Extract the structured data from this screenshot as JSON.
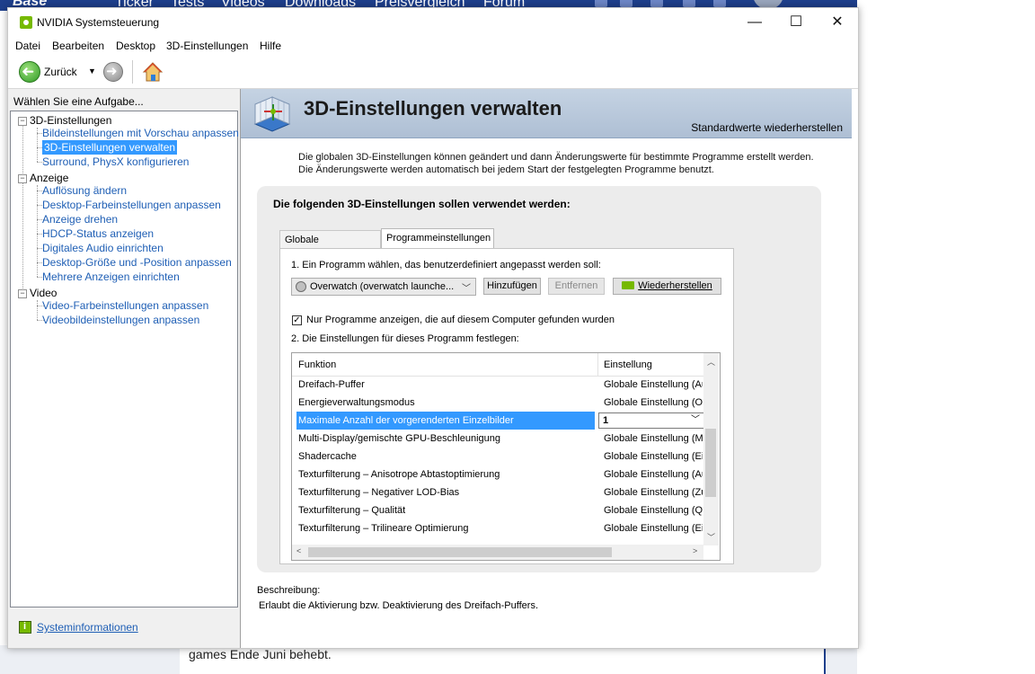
{
  "background_page": {
    "brand": "Base",
    "nav_items": [
      "Ticker",
      "Tests",
      "Videos",
      "Downloads",
      "Preisvergleich",
      "Forum"
    ],
    "article_text": "games Ende Juni behebt."
  },
  "window": {
    "title": "NVIDIA Systemsteuerung",
    "controls": {
      "minimize": "—",
      "maximize": "☐",
      "close": "✕"
    }
  },
  "menu": [
    "Datei",
    "Bearbeiten",
    "Desktop",
    "3D-Einstellungen",
    "Hilfe"
  ],
  "toolbar": {
    "back_label": "Zurück"
  },
  "left_panel": {
    "header": "Wählen Sie eine Aufgabe...",
    "groups": [
      {
        "label": "3D-Einstellungen",
        "items": [
          "Bildeinstellungen mit Vorschau anpassen",
          "3D-Einstellungen verwalten",
          "Surround, PhysX konfigurieren"
        ]
      },
      {
        "label": "Anzeige",
        "items": [
          "Auflösung ändern",
          "Desktop-Farbeinstellungen anpassen",
          "Anzeige drehen",
          "HDCP-Status anzeigen",
          "Digitales Audio einrichten",
          "Desktop-Größe und -Position anpassen",
          "Mehrere Anzeigen einrichten"
        ]
      },
      {
        "label": "Video",
        "items": [
          "Video-Farbeinstellungen anpassen",
          "Videobildeinstellungen anpassen"
        ]
      }
    ],
    "selected_item": "3D-Einstellungen verwalten",
    "system_info_link": "Systeminformationen"
  },
  "main": {
    "title": "3D-Einstellungen verwalten",
    "restore_defaults": "Standardwerte wiederherstellen",
    "intro": "Die globalen 3D-Einstellungen können geändert und dann Änderungswerte für bestimmte Programme erstellt werden. Die Änderungswerte werden automatisch bei jedem Start der festgelegten Programme benutzt.",
    "group_heading": "Die folgenden 3D-Einstellungen sollen verwendet werden:",
    "tabs": [
      "Globale Einstellungen",
      "Programmeinstellungen"
    ],
    "active_tab": "Programmeinstellungen",
    "step1_label": "1. Ein Programm wählen, das benutzerdefiniert angepasst werden soll:",
    "program_value": "Overwatch (overwatch launche...",
    "add_button": "Hinzufügen",
    "remove_button": "Entfernen",
    "restore_button": "Wiederherstellen",
    "show_only_found": {
      "label": "Nur Programme anzeigen, die auf diesem Computer gefunden wurden",
      "checked": true
    },
    "step2_label": "2. Die Einstellungen für dieses Programm festlegen:",
    "grid": {
      "columns": [
        "Funktion",
        "Einstellung"
      ],
      "rows": [
        {
          "function": "Dreifach-Puffer",
          "setting": "Globale Einstellung (Au"
        },
        {
          "function": "Energieverwaltungsmodus",
          "setting": "Globale Einstellung (Op"
        },
        {
          "function": "Maximale Anzahl der vorgerenderten Einzelbilder",
          "setting": "1"
        },
        {
          "function": "Multi-Display/gemischte GPU-Beschleunigung",
          "setting": "Globale Einstellung (Mu"
        },
        {
          "function": "Shadercache",
          "setting": "Globale Einstellung (Ein"
        },
        {
          "function": "Texturfilterung – Anisotrope Abtastoptimierung",
          "setting": "Globale Einstellung (Au"
        },
        {
          "function": "Texturfilterung – Negativer LOD-Bias",
          "setting": "Globale Einstellung (Zul"
        },
        {
          "function": "Texturfilterung – Qualität",
          "setting": "Globale Einstellung (Qu"
        },
        {
          "function": "Texturfilterung – Trilineare Optimierung",
          "setting": "Globale Einstellung (Ein"
        }
      ],
      "selected_row": 2
    },
    "description_label": "Beschreibung:",
    "description_text": "Erlaubt die Aktivierung bzw. Deaktivierung des Dreifach-Puffers."
  },
  "colors": {
    "nvidia_green": "#76b900",
    "selection": "#3399ff",
    "link": "#1f5fb5",
    "banner": "#b8c8db",
    "site_header": "#1e3f8c"
  }
}
